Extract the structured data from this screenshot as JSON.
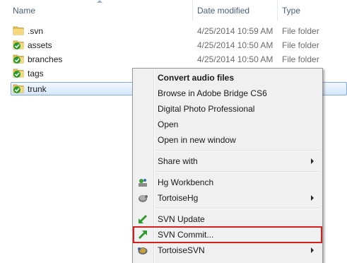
{
  "columns": {
    "name": "Name",
    "date_modified": "Date modified",
    "type": "Type"
  },
  "files": [
    {
      "name": ".svn",
      "date": "4/25/2014 10:59 AM",
      "type": "File folder",
      "icon": "folder-icon"
    },
    {
      "name": "assets",
      "date": "4/25/2014 10:50 AM",
      "type": "File folder",
      "icon": "svn-folder-icon"
    },
    {
      "name": "branches",
      "date": "4/25/2014 10:50 AM",
      "type": "File folder",
      "icon": "svn-folder-icon"
    },
    {
      "name": "tags",
      "date": "",
      "type": "",
      "icon": "svn-folder-icon"
    },
    {
      "name": "trunk",
      "date": "",
      "type": "",
      "icon": "svn-folder-icon",
      "selected": true
    }
  ],
  "context_menu": {
    "items": [
      {
        "label": "Convert audio files",
        "bold": true
      },
      {
        "label": "Browse in Adobe Bridge CS6"
      },
      {
        "label": "Digital Photo Professional"
      },
      {
        "label": "Open"
      },
      {
        "label": "Open in new window"
      },
      {
        "label": "Share with",
        "submenu": true
      },
      {
        "label": "Hg Workbench",
        "icon": "hg-workbench-icon"
      },
      {
        "label": "TortoiseHg",
        "icon": "tortoisehg-icon",
        "submenu": true
      },
      {
        "label": "SVN Update",
        "icon": "svn-update-icon"
      },
      {
        "label": "SVN Commit...",
        "icon": "svn-commit-icon",
        "highlighted": true
      },
      {
        "label": "TortoiseSVN",
        "icon": "tortoisesvn-icon",
        "submenu": true
      }
    ]
  },
  "colors": {
    "selection_border": "#84acdd",
    "highlight_box": "#d62020",
    "header_text": "#4c607a",
    "svn_check": "#2a9a2a",
    "folder": "#e8c25a"
  }
}
